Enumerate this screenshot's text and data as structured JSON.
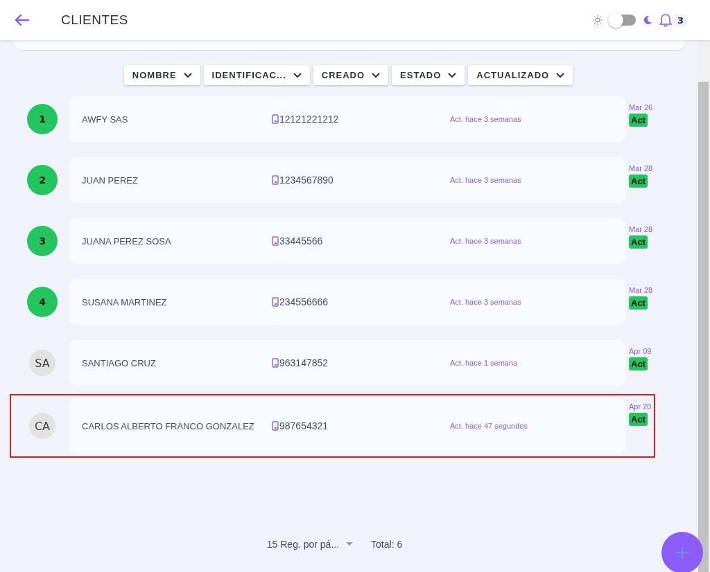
{
  "header": {
    "title": "CLIENTES",
    "dark_mode": false,
    "notifications": "3"
  },
  "filters": [
    "NOMBRE",
    "IDENTIFICAC...",
    "CREADO",
    "ESTADO",
    "ACTUALIZADO"
  ],
  "rows": [
    {
      "kind": "number",
      "avatar": "1",
      "name": "AWFY SAS",
      "phone": "12121221212",
      "updated": "Act. hace 3 semanas",
      "date": "Mar 26",
      "status": "Act",
      "highlighted": false
    },
    {
      "kind": "number",
      "avatar": "2",
      "name": "JUAN PEREZ",
      "phone": "1234567890",
      "updated": "Act. hace 3 semanas",
      "date": "Mar 28",
      "status": "Act",
      "highlighted": false
    },
    {
      "kind": "number",
      "avatar": "3",
      "name": "JUANA PEREZ SOSA",
      "phone": "33445566",
      "updated": "Act. hace 3 semanas",
      "date": "Mar 28",
      "status": "Act",
      "highlighted": false
    },
    {
      "kind": "number",
      "avatar": "4",
      "name": "SUSANA MARTINEZ",
      "phone": "234556666",
      "updated": "Act. hace 3 semanas",
      "date": "Mar 28",
      "status": "Act",
      "highlighted": false
    },
    {
      "kind": "initials",
      "avatar": "SA",
      "name": "SANTIAGO CRUZ",
      "phone": "963147852",
      "updated": "Act. hace 1 semana",
      "date": "Apr 09",
      "status": "Act",
      "highlighted": false
    },
    {
      "kind": "initials",
      "avatar": "CA",
      "name": "CARLOS ALBERTO FRANCO GONZALEZ",
      "phone": "987654321",
      "updated": "Act. hace 47 segundos",
      "date": "Apr 20",
      "status": "Act",
      "highlighted": true
    }
  ],
  "footer": {
    "per_page": "15 Reg. por pá...",
    "total": "Total: 6"
  }
}
